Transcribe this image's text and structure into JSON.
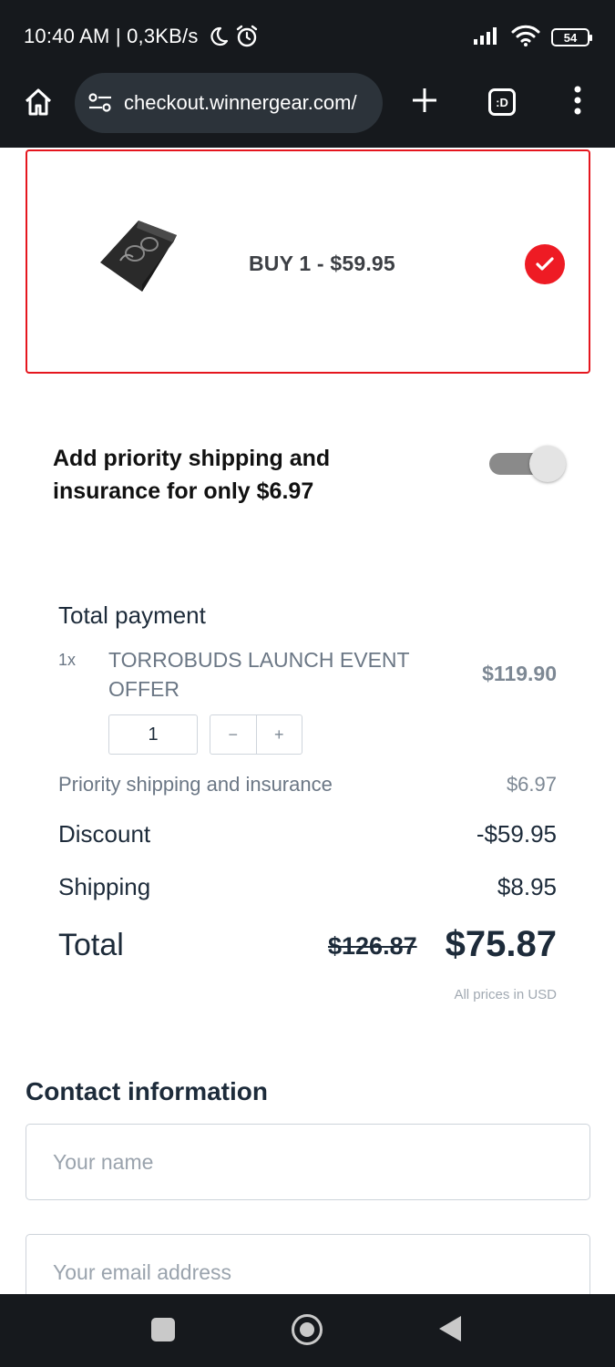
{
  "status_bar": {
    "time": "10:40 AM | 0,3KB/s",
    "battery": "54"
  },
  "browser": {
    "url": "checkout.winnergear.com/",
    "tabs_label": ":D"
  },
  "offer": {
    "label": "BUY 1 - $59.95",
    "selected": true
  },
  "priority_shipping": {
    "text": "Add priority shipping and insurance for only $6.97",
    "enabled": false
  },
  "summary": {
    "title": "Total payment",
    "item_qty_prefix": "1x",
    "item_name": "TORROBUDS LAUNCH EVENT OFFER",
    "item_price": "$119.90",
    "quantity": "1",
    "decrement": "−",
    "increment": "+",
    "rows": [
      {
        "label": "Priority shipping and insurance",
        "value": "$6.97"
      },
      {
        "label": "Discount",
        "value": "-$59.95"
      },
      {
        "label": "Shipping",
        "value": "$8.95"
      }
    ],
    "total_label": "Total",
    "total_old": "$126.87",
    "total_new": "$75.87",
    "currency_note": "All prices in USD"
  },
  "contact": {
    "title": "Contact information",
    "name_placeholder": "Your name",
    "email_placeholder": "Your email address"
  },
  "colors": {
    "accent_red": "#ee1b24",
    "text_dark": "#1d2b3a",
    "chrome_dark": "#16191d"
  }
}
